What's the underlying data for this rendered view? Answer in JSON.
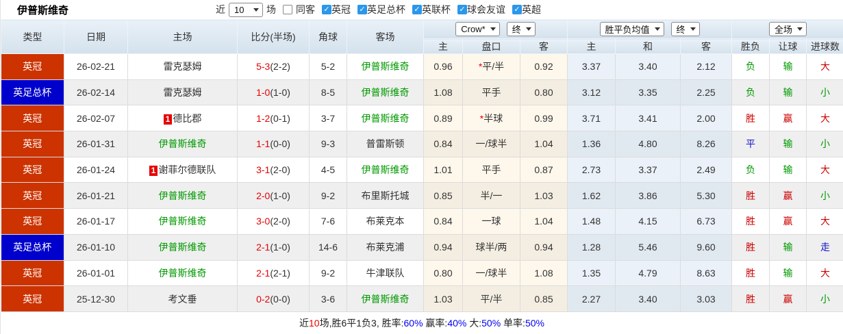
{
  "title": "伊普斯维奇",
  "filter_bar": {
    "recent_label": "近",
    "recent_count": "10",
    "unit_label": "场",
    "same_opponent": {
      "label": "同客",
      "checked": false
    },
    "leagues": [
      {
        "label": "英冠",
        "checked": true
      },
      {
        "label": "英足总杯",
        "checked": true
      },
      {
        "label": "英联杯",
        "checked": true
      },
      {
        "label": "球会友谊",
        "checked": true
      },
      {
        "label": "英超",
        "checked": true
      }
    ],
    "check_glyph": "✓"
  },
  "table": {
    "headers": {
      "type": "类型",
      "date": "日期",
      "home": "主场",
      "score": "比分(半场)",
      "corner": "角球",
      "away": "客场",
      "odds_home": "主",
      "odds_handicap": "盘口",
      "odds_away": "客",
      "avg_home": "主",
      "avg_draw": "和",
      "avg_away": "客",
      "result": "胜负",
      "handicap_result": "让球",
      "goals": "进球数"
    },
    "selects": {
      "bookmaker": "Crow*",
      "bookmaker_state": "终",
      "avg_label": "胜平负均值",
      "avg_state": "终",
      "scope": "全场"
    },
    "rows": [
      {
        "league": "英冠",
        "league_color": "red",
        "date": "26-02-21",
        "home": "雷克瑟姆",
        "home_color": "black",
        "home_badge": "",
        "score": "5-3",
        "half": "(2-2)",
        "corners": "5-2",
        "away": "伊普斯维奇",
        "away_color": "green",
        "odds_home": "0.96",
        "handicap_star": "*",
        "handicap": "平/半",
        "odds_away": "0.92",
        "avg_home": "3.37",
        "avg_draw": "3.40",
        "avg_away": "2.12",
        "result": "负",
        "result_color": "green",
        "let_result": "输",
        "let_color": "green",
        "goal_result": "大",
        "goal_color": "red"
      },
      {
        "league": "英足总杯",
        "league_color": "blue",
        "date": "26-02-14",
        "home": "雷克瑟姆",
        "home_color": "black",
        "home_badge": "",
        "score": "1-0",
        "half": "(1-0)",
        "corners": "8-5",
        "away": "伊普斯维奇",
        "away_color": "green",
        "odds_home": "1.08",
        "handicap_star": "",
        "handicap": "平手",
        "odds_away": "0.80",
        "avg_home": "3.12",
        "avg_draw": "3.35",
        "avg_away": "2.25",
        "result": "负",
        "result_color": "green",
        "let_result": "输",
        "let_color": "green",
        "goal_result": "小",
        "goal_color": "green"
      },
      {
        "league": "英冠",
        "league_color": "red",
        "date": "26-02-07",
        "home": "德比郡",
        "home_color": "black",
        "home_badge": "1",
        "score": "1-2",
        "half": "(0-1)",
        "corners": "3-7",
        "away": "伊普斯维奇",
        "away_color": "green",
        "odds_home": "0.89",
        "handicap_star": "*",
        "handicap": "半球",
        "odds_away": "0.99",
        "avg_home": "3.71",
        "avg_draw": "3.41",
        "avg_away": "2.00",
        "result": "胜",
        "result_color": "red",
        "let_result": "赢",
        "let_color": "red",
        "goal_result": "大",
        "goal_color": "red"
      },
      {
        "league": "英冠",
        "league_color": "red",
        "date": "26-01-31",
        "home": "伊普斯维奇",
        "home_color": "green",
        "home_badge": "",
        "score": "1-1",
        "half": "(0-0)",
        "corners": "9-3",
        "away": "普雷斯顿",
        "away_color": "black",
        "odds_home": "0.84",
        "handicap_star": "",
        "handicap": "一/球半",
        "odds_away": "1.04",
        "avg_home": "1.36",
        "avg_draw": "4.80",
        "avg_away": "8.26",
        "result": "平",
        "result_color": "blue",
        "let_result": "输",
        "let_color": "green",
        "goal_result": "小",
        "goal_color": "green"
      },
      {
        "league": "英冠",
        "league_color": "red",
        "date": "26-01-24",
        "home": "谢菲尔德联队",
        "home_color": "black",
        "home_badge": "1",
        "score": "3-1",
        "half": "(2-0)",
        "corners": "4-5",
        "away": "伊普斯维奇",
        "away_color": "green",
        "odds_home": "1.01",
        "handicap_star": "",
        "handicap": "平手",
        "odds_away": "0.87",
        "avg_home": "2.73",
        "avg_draw": "3.37",
        "avg_away": "2.49",
        "result": "负",
        "result_color": "green",
        "let_result": "输",
        "let_color": "green",
        "goal_result": "大",
        "goal_color": "red"
      },
      {
        "league": "英冠",
        "league_color": "red",
        "date": "26-01-21",
        "home": "伊普斯维奇",
        "home_color": "green",
        "home_badge": "",
        "score": "2-0",
        "half": "(1-0)",
        "corners": "9-2",
        "away": "布里斯托城",
        "away_color": "black",
        "odds_home": "0.85",
        "handicap_star": "",
        "handicap": "半/一",
        "odds_away": "1.03",
        "avg_home": "1.62",
        "avg_draw": "3.86",
        "avg_away": "5.30",
        "result": "胜",
        "result_color": "red",
        "let_result": "赢",
        "let_color": "red",
        "goal_result": "小",
        "goal_color": "green"
      },
      {
        "league": "英冠",
        "league_color": "red",
        "date": "26-01-17",
        "home": "伊普斯维奇",
        "home_color": "green",
        "home_badge": "",
        "score": "3-0",
        "half": "(2-0)",
        "corners": "7-6",
        "away": "布莱克本",
        "away_color": "black",
        "odds_home": "0.84",
        "handicap_star": "",
        "handicap": "一球",
        "odds_away": "1.04",
        "avg_home": "1.48",
        "avg_draw": "4.15",
        "avg_away": "6.73",
        "result": "胜",
        "result_color": "red",
        "let_result": "赢",
        "let_color": "red",
        "goal_result": "大",
        "goal_color": "red"
      },
      {
        "league": "英足总杯",
        "league_color": "blue",
        "date": "26-01-10",
        "home": "伊普斯维奇",
        "home_color": "green",
        "home_badge": "",
        "score": "2-1",
        "half": "(1-0)",
        "corners": "14-6",
        "away": "布莱克浦",
        "away_color": "black",
        "odds_home": "0.94",
        "handicap_star": "",
        "handicap": "球半/两",
        "odds_away": "0.94",
        "avg_home": "1.28",
        "avg_draw": "5.46",
        "avg_away": "9.60",
        "result": "胜",
        "result_color": "red",
        "let_result": "输",
        "let_color": "green",
        "goal_result": "走",
        "goal_color": "blue"
      },
      {
        "league": "英冠",
        "league_color": "red",
        "date": "26-01-01",
        "home": "伊普斯维奇",
        "home_color": "green",
        "home_badge": "",
        "score": "2-1",
        "half": "(2-1)",
        "corners": "9-2",
        "away": "牛津联队",
        "away_color": "black",
        "odds_home": "0.80",
        "handicap_star": "",
        "handicap": "一/球半",
        "odds_away": "1.08",
        "avg_home": "1.35",
        "avg_draw": "4.79",
        "avg_away": "8.63",
        "result": "胜",
        "result_color": "red",
        "let_result": "输",
        "let_color": "green",
        "goal_result": "大",
        "goal_color": "red"
      },
      {
        "league": "英冠",
        "league_color": "red",
        "date": "25-12-30",
        "home": "考文垂",
        "home_color": "black",
        "home_badge": "",
        "score": "0-2",
        "half": "(0-0)",
        "corners": "3-6",
        "away": "伊普斯维奇",
        "away_color": "green",
        "odds_home": "1.03",
        "handicap_star": "",
        "handicap": "平/半",
        "odds_away": "0.85",
        "avg_home": "2.27",
        "avg_draw": "3.40",
        "avg_away": "3.03",
        "result": "胜",
        "result_color": "red",
        "let_result": "赢",
        "let_color": "red",
        "goal_result": "小",
        "goal_color": "green"
      }
    ]
  },
  "footer": {
    "parts": [
      {
        "text": "近",
        "color": "black"
      },
      {
        "text": "10",
        "color": "red"
      },
      {
        "text": "场,胜6平1负3, 胜率:",
        "color": "black"
      },
      {
        "text": "60%",
        "color": "blue"
      },
      {
        "text": " 赢率:",
        "color": "black"
      },
      {
        "text": "40%",
        "color": "blue"
      },
      {
        "text": " 大:",
        "color": "black"
      },
      {
        "text": "50%",
        "color": "blue"
      },
      {
        "text": " 单率:",
        "color": "black"
      },
      {
        "text": "50%",
        "color": "blue"
      }
    ]
  },
  "colors": {
    "league_red": "#cc3300",
    "league_blue": "#0000cc",
    "score_red": "#e60000",
    "team_green": "#009900",
    "win_red": "#cc0000",
    "draw_blue": "#1414cc",
    "lose_green": "#009900",
    "checkbox_blue": "#2b97ea"
  }
}
